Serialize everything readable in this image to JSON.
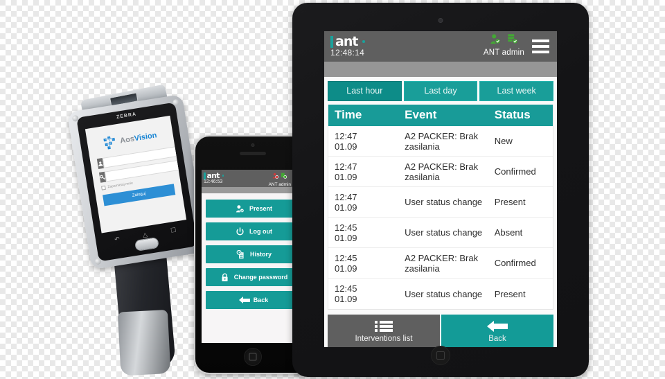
{
  "tablet": {
    "header": {
      "logo_text": "ant",
      "clock": "12:48:14",
      "user_label": "ANT admin",
      "icons": [
        "user-status-ok-icon",
        "device-status-ok-icon",
        "hamburger-menu-icon"
      ]
    },
    "tabs": [
      {
        "label": "Last hour",
        "active": true
      },
      {
        "label": "Last day",
        "active": false
      },
      {
        "label": "Last week",
        "active": false
      }
    ],
    "table": {
      "columns": [
        "Time",
        "Event",
        "Status"
      ],
      "rows": [
        {
          "time_1": "12:47",
          "time_2": "01.09",
          "event": "A2 PACKER: Brak zasilania",
          "status": "New"
        },
        {
          "time_1": "12:47",
          "time_2": "01.09",
          "event": "A2 PACKER: Brak zasilania",
          "status": "Confirmed"
        },
        {
          "time_1": "12:47",
          "time_2": "01.09",
          "event": "User status change",
          "status": "Present"
        },
        {
          "time_1": "12:45",
          "time_2": "01.09",
          "event": "User status change",
          "status": "Absent"
        },
        {
          "time_1": "12:45",
          "time_2": "01.09",
          "event": "A2 PACKER: Brak zasilania",
          "status": "Confirmed"
        },
        {
          "time_1": "12:45",
          "time_2": "01.09",
          "event": "User status change",
          "status": "Present"
        }
      ]
    },
    "bottom_bar": [
      {
        "label": "Interventions list",
        "icon": "list-icon",
        "style": "grey"
      },
      {
        "label": "Back",
        "icon": "back-arrow-icon",
        "style": "teal"
      }
    ]
  },
  "phone": {
    "header": {
      "logo_text": "ant",
      "clock": "12:46:53",
      "user_label": "ANT admin"
    },
    "menu": [
      {
        "label": "Present",
        "icon": "user-check-icon"
      },
      {
        "label": "Log out",
        "icon": "power-icon"
      },
      {
        "label": "History",
        "icon": "history-clock-icon"
      },
      {
        "label": "Change password",
        "icon": "lock-icon"
      },
      {
        "label": "Back",
        "icon": "back-arrow-icon"
      }
    ]
  },
  "zebra": {
    "brand": "ZEBRA",
    "app_logo": {
      "prefix": "Aos",
      "suffix": "Vision"
    },
    "form": {
      "username_placeholder": "",
      "password_placeholder": "",
      "remember_label": "Zapamietaj mnie",
      "submit_label": "Zaloguj"
    },
    "nav": [
      "back-icon",
      "home-icon",
      "recents-icon"
    ]
  },
  "colors": {
    "teal": "#189b98",
    "teal_dark": "#0d8c88",
    "header_grey": "#5f5f5f",
    "subbar_grey": "#969696",
    "status_green": "#43a834",
    "status_red": "#d2393a",
    "aos_blue": "#1b86d4"
  }
}
